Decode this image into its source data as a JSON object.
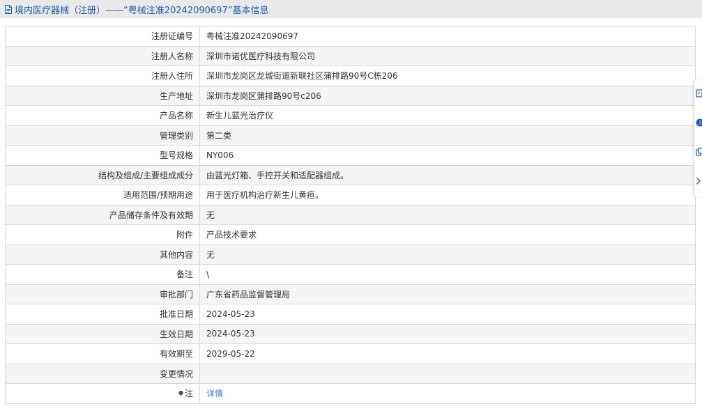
{
  "header": {
    "icon": "document-icon",
    "title": "境内医疗器械（注册）——“粤械注准20242090697”基本信息"
  },
  "rows": [
    {
      "label": "注册证编号",
      "value": "粤械注准20242090697"
    },
    {
      "label": "注册人名称",
      "value": "深圳市诺优医疗科技有限公司"
    },
    {
      "label": "注册人住所",
      "value": "深圳市龙岗区龙城街道新联社区蒲排路90号C栋206"
    },
    {
      "label": "生产地址",
      "value": "深圳市龙岗区蒲排路90号c206"
    },
    {
      "label": "产品名称",
      "value": "新生儿蓝光治疗仪"
    },
    {
      "label": "管理类别",
      "value": "第二类"
    },
    {
      "label": "型号规格",
      "value": "NY006"
    },
    {
      "label": "结构及组成/主要组成成分",
      "value": "由蓝光灯箱、手控开关和适配器组成。"
    },
    {
      "label": "适用范围/预期用途",
      "value": "用于医疗机构治疗新生儿黄疸。"
    },
    {
      "label": "产品储存条件及有效期",
      "value": "无"
    },
    {
      "label": "附件",
      "value": "产品技术要求"
    },
    {
      "label": "其他内容",
      "value": "无"
    },
    {
      "label": "备注",
      "value": "\\"
    },
    {
      "label": "审批部门",
      "value": "广东省药品监督管理局"
    },
    {
      "label": "批准日期",
      "value": "2024-05-23"
    },
    {
      "label": "生效日期",
      "value": "2024-05-23"
    },
    {
      "label": "有效期至",
      "value": "2029-05-22"
    },
    {
      "label": "变更情况",
      "value": ""
    }
  ],
  "note_row": {
    "icon": "pin-icon",
    "label": "注",
    "link_text": "详情"
  },
  "side_toolbar": {
    "icons": [
      "edit-icon",
      "help-icon",
      "copy-icon",
      "collapse-arrow-icon"
    ],
    "accent": "#1f5fa8"
  }
}
